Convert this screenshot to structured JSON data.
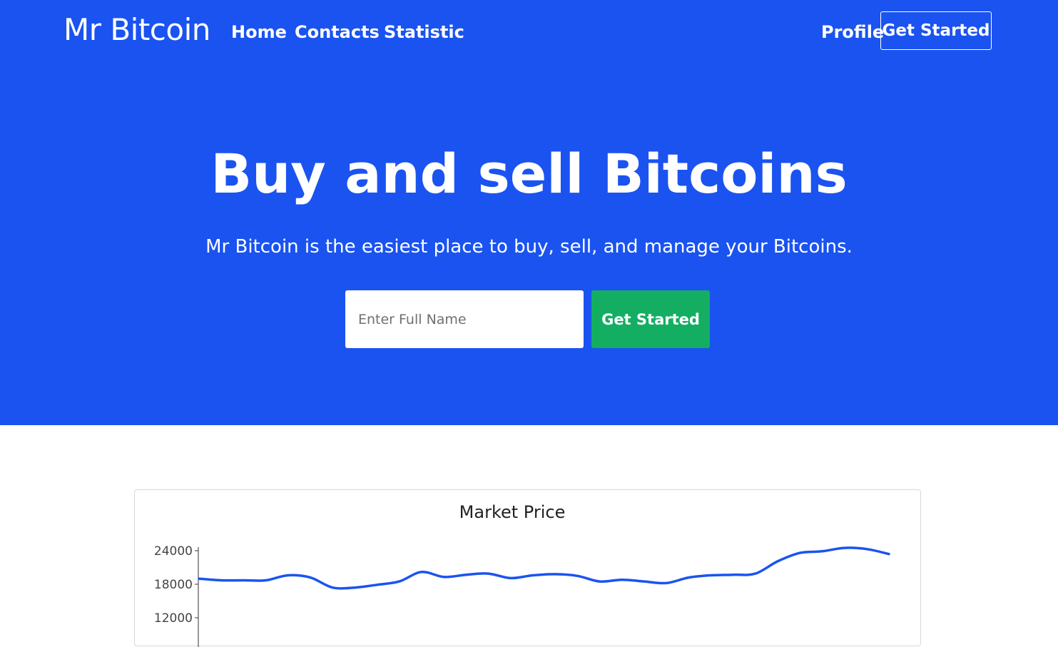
{
  "nav": {
    "brand": "Mr Bitcoin",
    "links": [
      "Home",
      "Contacts",
      "Statistic"
    ],
    "profile": "Profile",
    "cta": "Get Started"
  },
  "hero": {
    "title": "Buy and sell Bitcoins",
    "subtitle": "Mr Bitcoin is the easiest place to buy, sell, and manage your Bitcoins.",
    "input_placeholder": "Enter Full Name",
    "input_value": "",
    "button": "Get Started"
  },
  "colors": {
    "hero_bg": "#1a53f0",
    "button_green": "#13ae62",
    "line": "#1a53f0"
  },
  "chart_data": {
    "type": "line",
    "title": "Market Price",
    "xlabel": "",
    "ylabel": "",
    "y_ticks": [
      24000,
      18000,
      12000
    ],
    "ylim": [
      6000,
      24500
    ],
    "grid": false,
    "series": [
      {
        "values": [
          19000,
          18700,
          18700,
          18700,
          19600,
          19200,
          17400,
          17400,
          17900,
          18500,
          20200,
          19300,
          19700,
          19900,
          19100,
          19600,
          19800,
          19500,
          18500,
          18800,
          18500,
          18200,
          19200,
          19600,
          19700,
          19900,
          22100,
          23600,
          23900,
          24500,
          24300,
          23400
        ]
      }
    ]
  }
}
